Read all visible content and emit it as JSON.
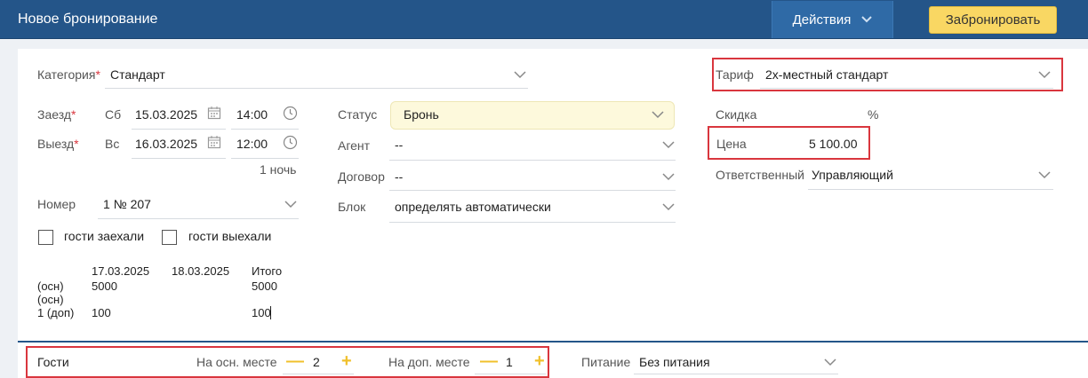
{
  "header": {
    "title": "Новое бронирование",
    "actions_label": "Действия",
    "book_label": "Забронировать"
  },
  "form": {
    "category_label": "Категория",
    "category_value": "Стандарт",
    "checkin_label": "Заезд",
    "checkin_day": "Сб",
    "checkin_date": "15.03.2025",
    "checkin_time": "14:00",
    "checkout_label": "Выезд",
    "checkout_day": "Вс",
    "checkout_date": "16.03.2025",
    "checkout_time": "12:00",
    "nights": "1 ночь",
    "room_label": "Номер",
    "room_value": "1 № 207",
    "guests_in_label": "гости заехали",
    "guests_out_label": "гости выехали",
    "status_label": "Статус",
    "status_value": "Бронь",
    "agent_label": "Агент",
    "agent_value": "--",
    "contract_label": "Договор",
    "contract_value": "--",
    "block_label": "Блок",
    "block_value": "определять автоматически",
    "tariff_label": "Тариф",
    "tariff_value": "2х-местный стандарт",
    "discount_label": "Скидка",
    "discount_unit": "%",
    "price_label": "Цена",
    "price_value": "5 100.00",
    "responsible_label": "Ответственный",
    "responsible_value": "Управляющий"
  },
  "price_table": {
    "headers": [
      "17.03.2025",
      "18.03.2025",
      "Итого"
    ],
    "rows": [
      {
        "label": "(осн)",
        "cells": [
          "5000",
          "",
          "5000"
        ]
      },
      {
        "label": "(осн)",
        "cells": [
          "",
          "",
          ""
        ]
      },
      {
        "label": "1 (доп)",
        "cells": [
          "100",
          "",
          "100"
        ]
      }
    ]
  },
  "guests": {
    "label": "Гости",
    "main_label": "На осн. месте",
    "main_count": "2",
    "extra_label": "На доп. месте",
    "extra_count": "1",
    "minus": "—",
    "plus": "+",
    "meal_label": "Питание",
    "meal_value": "Без питания"
  },
  "colors": {
    "header_bg": "#245589",
    "accent_yellow": "#f9d763",
    "highlight_red": "#d9363e"
  }
}
